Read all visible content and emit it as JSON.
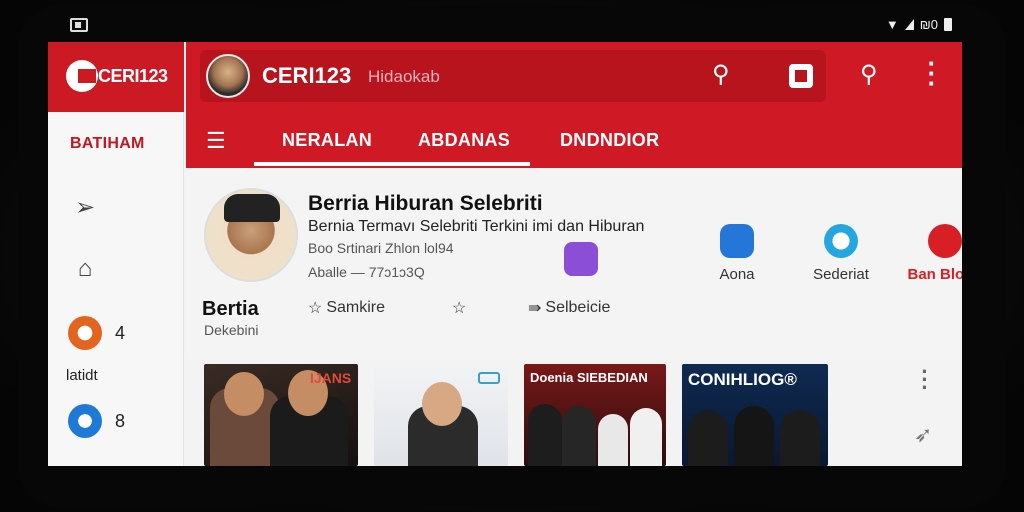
{
  "status": {
    "right_text": "₪0"
  },
  "sidebar": {
    "brand": "CERI123",
    "section_title": "BATIHAM",
    "items": [
      {
        "icon": "send-icon"
      },
      {
        "icon": "home-icon"
      },
      {
        "icon": "orange-badge-icon",
        "count": "4"
      },
      {
        "icon": "blue-badge-icon",
        "count": "8"
      }
    ],
    "label": "latidt"
  },
  "topbar": {
    "title": "CERI123",
    "subtitle": "Hidaokab",
    "tabs": [
      "NERALAN",
      "ABDANAS",
      "DNDNDIOR"
    ]
  },
  "profile": {
    "name": "Berria Hiburan Selebriti",
    "desc": "Bernia Termavı Selebriti Terkini imi dan Hiburan",
    "line3": "Boo Srtinari Zhlon lol94",
    "line4": "Aballe — 77ɔ1ɔ3Q",
    "actions": [
      {
        "label": "",
        "icon": "document-icon",
        "color": "#8a4fd6"
      },
      {
        "label": "Aona",
        "icon": "user-icon",
        "color": "#2477d9"
      },
      {
        "label": "Sederiat",
        "icon": "star-loop-icon",
        "color": "#26a6e0"
      },
      {
        "label": "Ban Blotat",
        "icon": "play-icon",
        "color": "#d81f26"
      }
    ],
    "bold_title": "Bertia",
    "bold_sub": "Dekebini",
    "buttons": [
      "Samkire",
      "",
      "Selbeicie"
    ]
  },
  "thumbs": [
    {
      "caption": "IJANS"
    },
    {
      "caption": ""
    },
    {
      "caption": "Doenia SIEBEDIAN"
    },
    {
      "caption": "CONIHLIOG®"
    }
  ],
  "colors": {
    "brand_red": "#cf1a25",
    "dark_red": "#b8141e"
  }
}
